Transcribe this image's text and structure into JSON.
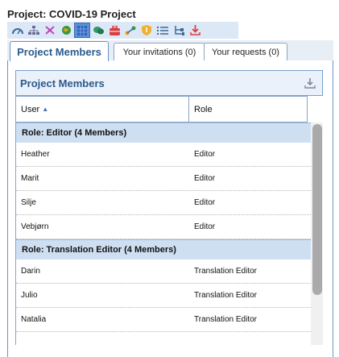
{
  "project": {
    "title": "Project: COVID-19 Project"
  },
  "toolbar": {
    "icons": [
      "dashboard-icon",
      "hierarchy-icon",
      "tools-icon",
      "globe-icon",
      "grid-icon",
      "chat-icon",
      "briefcase-icon",
      "workflow-icon",
      "shield-icon",
      "list-icon",
      "tree-icon",
      "download-icon"
    ],
    "active_icon": "grid-icon"
  },
  "tabs": [
    {
      "label": "Project Members"
    },
    {
      "label": "Your invitations (0)"
    },
    {
      "label": "Your requests (0)"
    }
  ],
  "panel": {
    "title": "Project Members"
  },
  "grid": {
    "columns": {
      "user": "User",
      "role": "Role"
    },
    "groups": [
      {
        "label": "Role: Editor (4 Members)",
        "rows": [
          {
            "user": "Heather",
            "role": "Editor"
          },
          {
            "user": "Marit",
            "role": "Editor"
          },
          {
            "user": "Silje",
            "role": "Editor"
          },
          {
            "user": "Vebjørn",
            "role": "Editor"
          }
        ]
      },
      {
        "label": "Role: Translation Editor (4 Members)",
        "rows": [
          {
            "user": "Darin",
            "role": "Translation Editor"
          },
          {
            "user": "Julio",
            "role": "Translation Editor"
          },
          {
            "user": "Natalia",
            "role": "Translation Editor"
          }
        ]
      }
    ]
  },
  "colors": {
    "accent": "#2a5a8c",
    "group_bg": "#cfdff2",
    "toolbar_bg": "#dde8f6",
    "border": "#6a95c9"
  }
}
